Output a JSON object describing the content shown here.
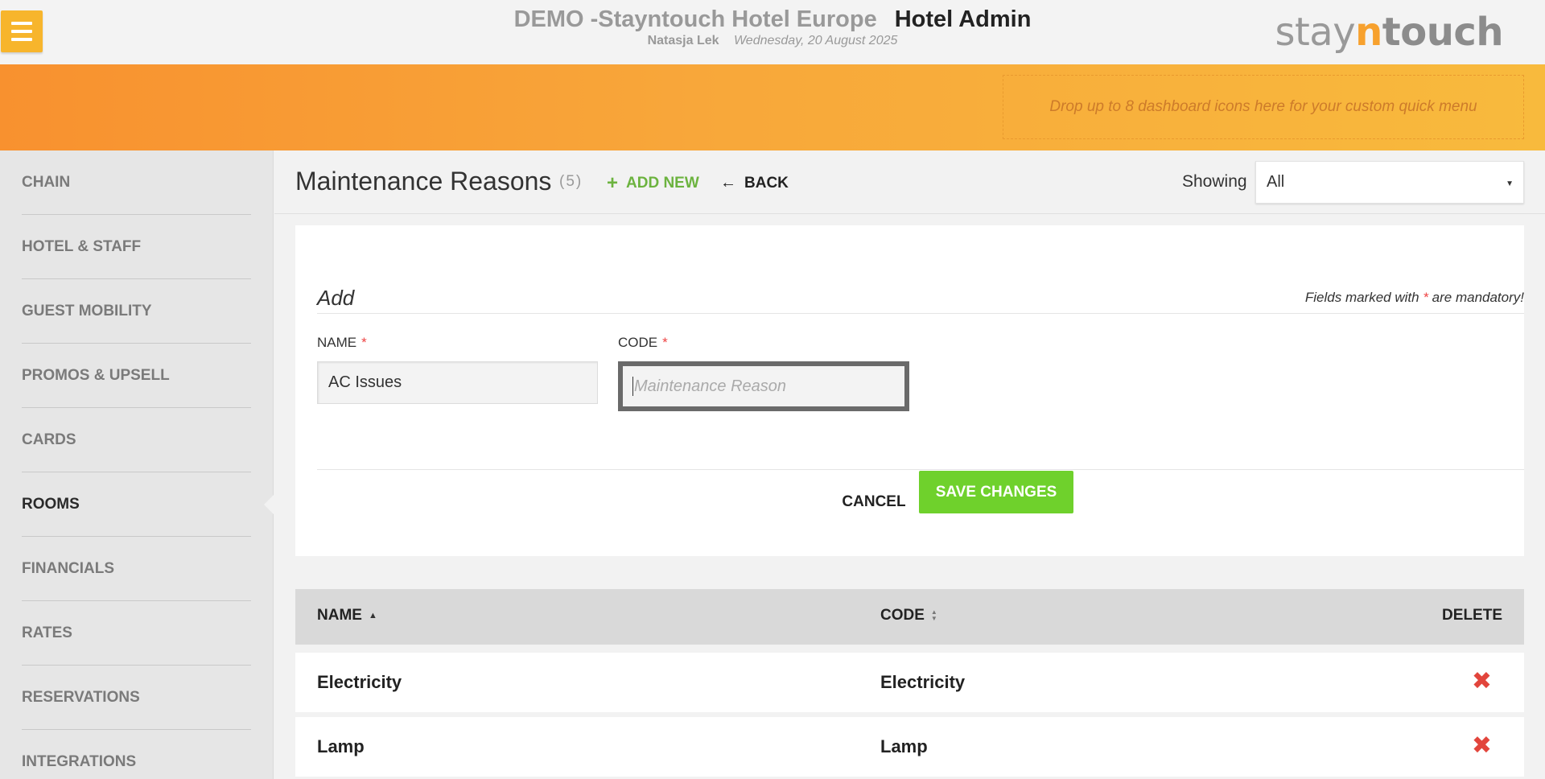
{
  "header": {
    "hotel_name": "DEMO -Stayntouch Hotel Europe",
    "app_name": "Hotel Admin",
    "user_name": "Natasja Lek",
    "date": "Wednesday, 20 August 2025",
    "brand": {
      "stay": "stay",
      "n": "n",
      "touch": "touch"
    }
  },
  "quick_menu": {
    "dropzone_text": "Drop up to 8 dashboard icons here for your custom quick menu"
  },
  "sidebar": {
    "items": [
      {
        "label": "CHAIN"
      },
      {
        "label": "HOTEL & STAFF"
      },
      {
        "label": "GUEST MOBILITY"
      },
      {
        "label": "PROMOS & UPSELL"
      },
      {
        "label": "CARDS"
      },
      {
        "label": "ROOMS"
      },
      {
        "label": "FINANCIALS"
      },
      {
        "label": "RATES"
      },
      {
        "label": "RESERVATIONS"
      },
      {
        "label": "INTEGRATIONS"
      }
    ],
    "active": "ROOMS"
  },
  "page": {
    "title": "Maintenance Reasons",
    "count": "(5)",
    "add_new": "ADD NEW",
    "back": "BACK",
    "showing_label": "Showing",
    "showing_value": "All"
  },
  "form": {
    "legend": "Add",
    "mandatory_prefix": "Fields marked with ",
    "mandatory_star": "*",
    "mandatory_suffix": " are mandatory!",
    "name_label": "NAME",
    "code_label": "CODE",
    "required_star": "*",
    "name_value": "AC Issues",
    "code_placeholder": "Maintenance Reason",
    "cancel": "CANCEL",
    "save": "SAVE CHANGES"
  },
  "table": {
    "headers": {
      "name": "NAME",
      "code": "CODE",
      "delete": "DELETE"
    },
    "rows": [
      {
        "name": "Electricity",
        "code": "Electricity"
      },
      {
        "name": "Lamp",
        "code": "Lamp"
      }
    ]
  },
  "colors": {
    "accent_orange": "#f8a73a",
    "menu_button": "#f7b52c",
    "add_new_green": "#6cb33f",
    "save_green": "#6fd12c",
    "delete_red": "#e2453c"
  },
  "icons": {
    "menu": "hamburger-icon",
    "add": "plus-icon",
    "back": "arrow-left-icon",
    "dropdown": "caret-down-icon",
    "sort_asc": "sort-ascending-icon",
    "sort_both": "sort-both-icon",
    "delete": "delete-x-icon"
  }
}
